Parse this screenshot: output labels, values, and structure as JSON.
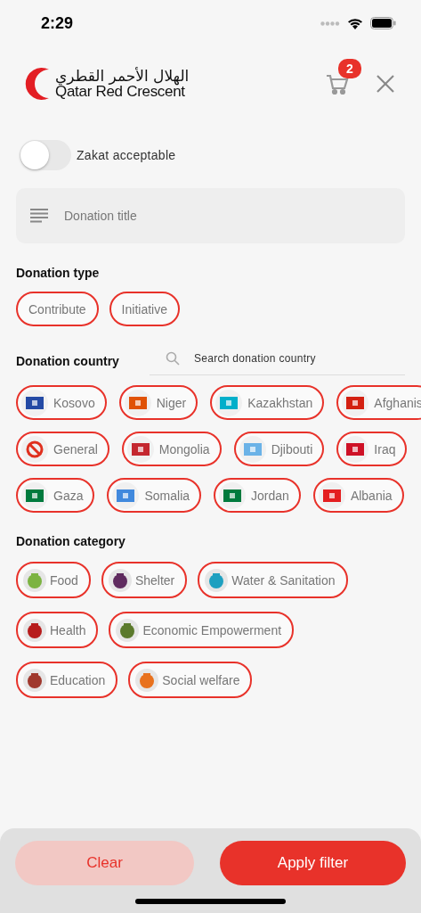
{
  "status_bar": {
    "time": "2:29"
  },
  "header": {
    "logo_arabic": "الهلال الأحمر القطري",
    "logo_english": "Qatar Red Crescent",
    "cart_count": "2"
  },
  "zakat_toggle": {
    "label": "Zakat acceptable",
    "on": false
  },
  "title_field": {
    "placeholder": "Donation title"
  },
  "donation_type": {
    "heading": "Donation type",
    "options": [
      {
        "label": "Contribute",
        "selected": true
      },
      {
        "label": "Initiative",
        "selected": true
      }
    ]
  },
  "donation_country": {
    "heading": "Donation country",
    "search_placeholder": "Search donation country",
    "rows": [
      {
        "chips": [
          {
            "label": "Kosovo",
            "kind": "flag",
            "color": "#244aa5",
            "selected": true
          },
          {
            "label": "Niger",
            "kind": "flag",
            "color": "#e05206",
            "selected": true
          },
          {
            "label": "Kazakhstan",
            "kind": "flag",
            "color": "#00afca",
            "selected": true
          },
          {
            "label": "Afghanis",
            "kind": "flag",
            "color": "#d32011",
            "selected": true
          }
        ]
      },
      {
        "chips": [
          {
            "label": "General",
            "kind": "general",
            "color": "#e0301e",
            "selected": true
          },
          {
            "label": "Mongolia",
            "kind": "flag",
            "color": "#c4272f",
            "selected": true
          },
          {
            "label": "Djibouti",
            "kind": "flag",
            "color": "#6ab2e7",
            "selected": true
          },
          {
            "label": "Iraq",
            "kind": "flag",
            "color": "#ce1126",
            "selected": true
          }
        ]
      },
      {
        "chips": [
          {
            "label": "Gaza",
            "kind": "flag",
            "color": "#007a3d",
            "selected": true
          },
          {
            "label": "Somalia",
            "kind": "flag",
            "color": "#4189dd",
            "selected": true
          },
          {
            "label": "Jordan",
            "kind": "flag",
            "color": "#007a3d",
            "selected": true
          },
          {
            "label": "Albania",
            "kind": "flag",
            "color": "#e41e20",
            "selected": true
          }
        ]
      }
    ]
  },
  "donation_category": {
    "heading": "Donation category",
    "options": [
      {
        "label": "Food",
        "color": "#7cb342",
        "selected": true
      },
      {
        "label": "Shelter",
        "color": "#5e2a5e",
        "selected": true
      },
      {
        "label": "Water & Sanitation",
        "color": "#1ea0c0",
        "selected": true
      },
      {
        "label": "Health",
        "color": "#b71c1c",
        "selected": true
      },
      {
        "label": "Economic Empowerment",
        "color": "#5b7a2c",
        "selected": true
      },
      {
        "label": "Education",
        "color": "#a0392e",
        "selected": true
      },
      {
        "label": "Social welfare",
        "color": "#e8711d",
        "selected": true
      }
    ]
  },
  "actions": {
    "clear": "Clear",
    "apply": "Apply filter"
  }
}
